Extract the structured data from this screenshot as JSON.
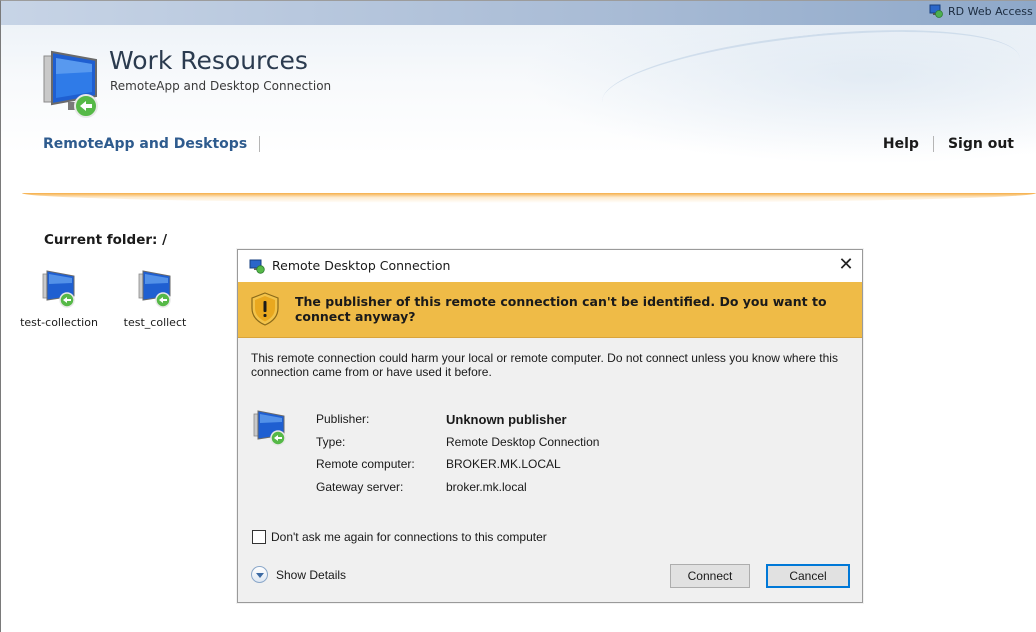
{
  "topbar": {
    "label": "RD Web Access",
    "icon": "rd-web-access-icon"
  },
  "header": {
    "title": "Work Resources",
    "subtitle": "RemoteApp and Desktop Connection",
    "logo_icon": "remote-desktop-monitor-icon"
  },
  "nav": {
    "left": "RemoteApp and Desktops",
    "help": "Help",
    "signout": "Sign out"
  },
  "folder": {
    "label": "Current folder: /"
  },
  "resources": [
    {
      "label": "test-collection",
      "icon": "remote-desktop-icon"
    },
    {
      "label": "test_collect",
      "icon": "remote-desktop-icon"
    }
  ],
  "dialog": {
    "title": "Remote Desktop Connection",
    "close_glyph": "✕",
    "warning": "The publisher of this remote connection can't be identified. Do you want to connect anyway?",
    "description": "This remote connection could harm your local or remote computer. Do not connect unless you know where this connection came from or have used it before.",
    "details": [
      {
        "key": "Publisher:",
        "value": "Unknown publisher"
      },
      {
        "key": "Type:",
        "value": "Remote Desktop Connection"
      },
      {
        "key": "Remote computer:",
        "value": "BROKER.MK.LOCAL"
      },
      {
        "key": "Gateway server:",
        "value": "broker.mk.local"
      }
    ],
    "checkbox_label": "Don't ask me again for connections to this computer",
    "checkbox_checked": false,
    "show_details": "Show Details",
    "connect": "Connect",
    "cancel": "Cancel"
  },
  "colors": {
    "warning_bar": "#efbb47",
    "nav_link": "#2e5b8e",
    "accent_rule": "#f4a028",
    "default_button_border": "#0078d7"
  }
}
